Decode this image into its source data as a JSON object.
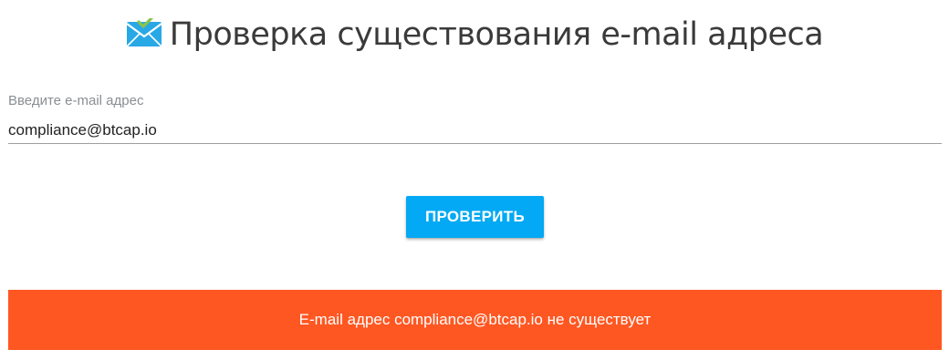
{
  "header": {
    "title": "Проверка существования e-mail адреса",
    "icon": "envelope-check-icon"
  },
  "email_field": {
    "label": "Введите e-mail адрес",
    "value": "compliance@btcap.io"
  },
  "check_button": {
    "label": "ПРОВЕРИТЬ"
  },
  "result": {
    "message": "E-mail адрес compliance@btcap.io не существует"
  },
  "colors": {
    "button": "#03a9f4",
    "result_banner": "#ff5722",
    "icon_envelope": "#29a8e6",
    "icon_check": "#8bc34a"
  }
}
